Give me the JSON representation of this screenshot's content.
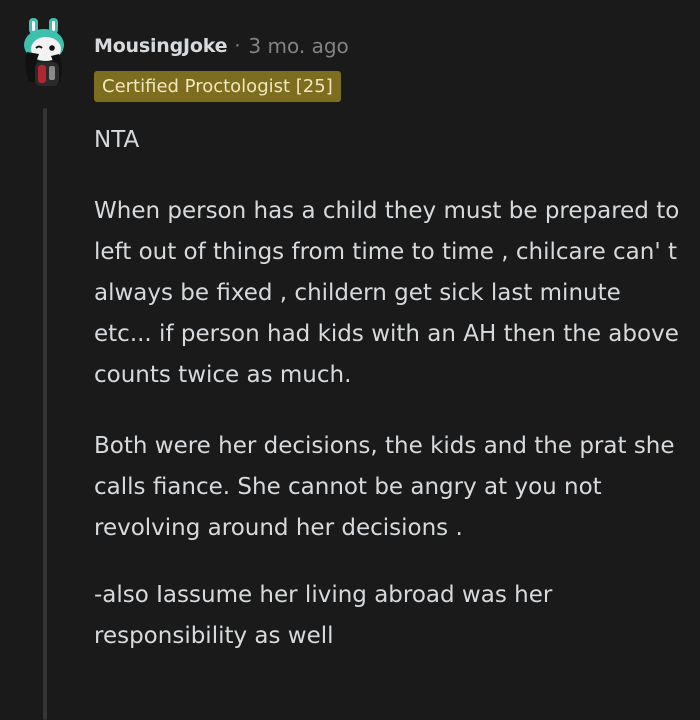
{
  "comment": {
    "username": "MousingJoke",
    "separator": "·",
    "timestamp": "3 mo. ago",
    "flair": "Certified Proctologist [25]",
    "paragraphs": [
      "NTA",
      "When person has a child they must be prepared to left out of things from time to time , chilcare can' t always be fixed , childern get sick last minute etc... if person had kids with an AH then the above counts twice as much.",
      "Both were her decisions, the kids and the prat she calls fiance. She cannot be angry at you not revolving around her decisions .",
      "-also Iassume her living abroad was her responsibility as well"
    ]
  },
  "colors": {
    "background": "#1a1a1b",
    "text": "#d7dadc",
    "meta": "#818384",
    "flair_bg": "#7d6d1e",
    "flair_text": "#f1e7bd",
    "thread_line": "#343536"
  },
  "icons": {
    "avatar": "snoo-bunny-avatar-icon"
  }
}
